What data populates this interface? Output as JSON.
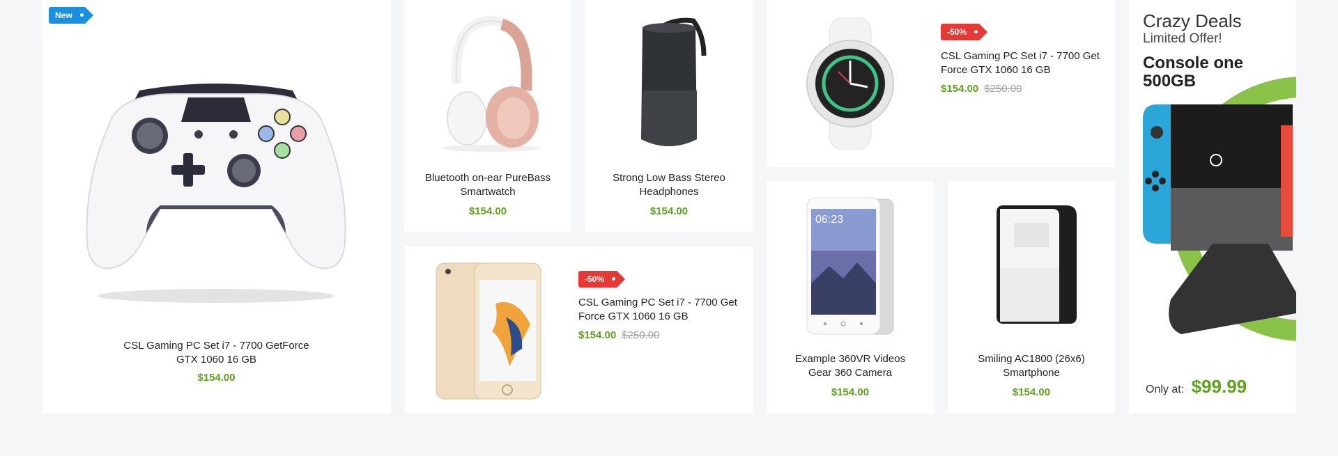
{
  "products": {
    "controller": {
      "badge": "New",
      "name_line1": "CSL Gaming PC Set i7 - 7700 GetForce",
      "name_line2": "GTX 1060 16 GB",
      "price": "$154.00"
    },
    "headphones": {
      "name_line1": "Bluetooth on-ear PureBass",
      "name_line2": "Smartwatch",
      "price": "$154.00"
    },
    "speaker": {
      "name_line1": "Strong Low Bass Stereo",
      "name_line2": "Headphones",
      "price": "$154.00"
    },
    "watch": {
      "badge": "-50%",
      "name_line1": "CSL Gaming PC Set i7 - 7700 Get",
      "name_line2": "Force GTX 1060 16 GB",
      "price": "$154.00",
      "old_price": "$250.00"
    },
    "iphone": {
      "badge": "-50%",
      "name_line1": "CSL Gaming PC Set i7 - 7700 Get",
      "name_line2": "Force GTX 1060 16 GB",
      "price": "$154.00",
      "old_price": "$250.00"
    },
    "phone": {
      "name_line1": "Example 360VR Videos",
      "name_line2": "Gear 360 Camera",
      "price": "$154.00"
    },
    "pc": {
      "name_line1": "Smiling AC1800 (26x6)",
      "name_line2": "Smartphone",
      "price": "$154.00"
    }
  },
  "deal": {
    "title": "Crazy Deals",
    "subtitle": "Limited Offer!",
    "product_line1": "Console one",
    "product_line2": "500GB",
    "only_at": "Only at:",
    "price": "$99.99"
  },
  "colors": {
    "price_green": "#5ea21e",
    "new_badge": "#1a8fde",
    "sale_badge": "#e53935",
    "old_price": "#9e9e9e",
    "background": "#f4f6f8"
  }
}
